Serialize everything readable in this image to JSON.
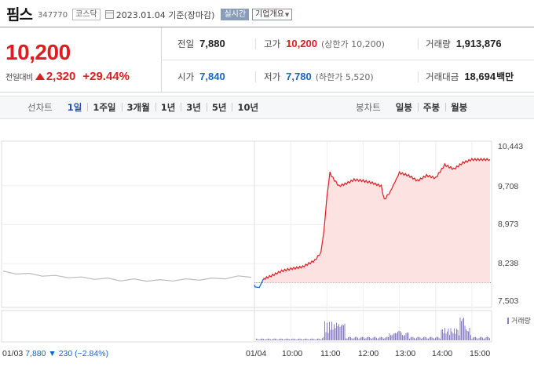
{
  "header": {
    "name": "핌스",
    "code": "347770",
    "market": "코스닥",
    "date": "2023.01.04 기준(장마감)",
    "realtime": "실시간",
    "company_info": "기업개요"
  },
  "summary": {
    "price": "10,200",
    "change_label": "전일대비",
    "change": "2,320",
    "change_pct": "+29.44%",
    "prev_close_label": "전일",
    "prev_close": "7,880",
    "high_label": "고가",
    "high": "10,200",
    "upper_limit": "(상한가 10,200)",
    "volume_label": "거래량",
    "volume": "1,913,876",
    "open_label": "시가",
    "open": "7,840",
    "low_label": "저가",
    "low": "7,780",
    "lower_limit": "(하한가 5,520)",
    "amount_label": "거래대금",
    "amount": "18,694",
    "amount_unit": "백만"
  },
  "toolbar": {
    "line_title": "선차트",
    "line_periods": [
      "1일",
      "1주일",
      "3개월",
      "1년",
      "3년",
      "5년",
      "10년"
    ],
    "active_period": "1일",
    "candle_title": "봉차트",
    "candle_periods": [
      "일봉",
      "주봉",
      "월봉"
    ]
  },
  "chart_data": {
    "type": "line",
    "y_ticks": [
      "10,443",
      "9,708",
      "8,973",
      "8,238",
      "7,503"
    ],
    "ylim": [
      7503,
      10443
    ],
    "x_ticks": [
      "01/03",
      "01/04",
      "10:00",
      "11:00",
      "12:00",
      "13:00",
      "14:00",
      "15:00"
    ],
    "baseline": 7880,
    "series": [
      {
        "values_prev_day": [
          8080,
          8060,
          8040,
          8020,
          8000,
          7990,
          7970,
          7960,
          7950,
          7930,
          7935,
          7925,
          7920,
          7930,
          7935,
          7945,
          7950,
          7970,
          7990,
          8000
        ],
        "values_today": [
          [
            "09:00",
            7840
          ],
          [
            "09:01",
            7800
          ],
          [
            "09:08",
            7790
          ],
          [
            "09:15",
            7950
          ],
          [
            "09:30",
            8020
          ],
          [
            "09:45",
            8100
          ],
          [
            "10:00",
            8140
          ],
          [
            "10:20",
            8180
          ],
          [
            "10:40",
            8300
          ],
          [
            "10:50",
            8450
          ],
          [
            "10:55",
            8850
          ],
          [
            "11:00",
            9500
          ],
          [
            "11:05",
            9950
          ],
          [
            "11:10",
            9850
          ],
          [
            "11:20",
            9700
          ],
          [
            "11:30",
            9740
          ],
          [
            "11:45",
            9820
          ],
          [
            "12:00",
            9800
          ],
          [
            "12:15",
            9760
          ],
          [
            "12:30",
            9700
          ],
          [
            "12:35",
            9440
          ],
          [
            "12:45",
            9600
          ],
          [
            "13:00",
            9950
          ],
          [
            "13:15",
            9900
          ],
          [
            "13:30",
            9800
          ],
          [
            "13:45",
            9900
          ],
          [
            "14:00",
            9850
          ],
          [
            "14:15",
            10100
          ],
          [
            "14:30",
            10020
          ],
          [
            "14:45",
            10140
          ],
          [
            "15:00",
            10200
          ],
          [
            "15:20",
            10200
          ],
          [
            "15:30",
            10200
          ]
        ]
      }
    ],
    "volume_legend": "거래량",
    "prev_info": {
      "date": "01/03",
      "close": "7,880",
      "change": "▼ 230",
      "pct": "(−2.84%)"
    }
  },
  "colors": {
    "up": "#e01c22",
    "down": "#1765c4",
    "fill": "#fde2e2",
    "prev": "#bbbbbb",
    "volume": "#8a7cc6"
  }
}
